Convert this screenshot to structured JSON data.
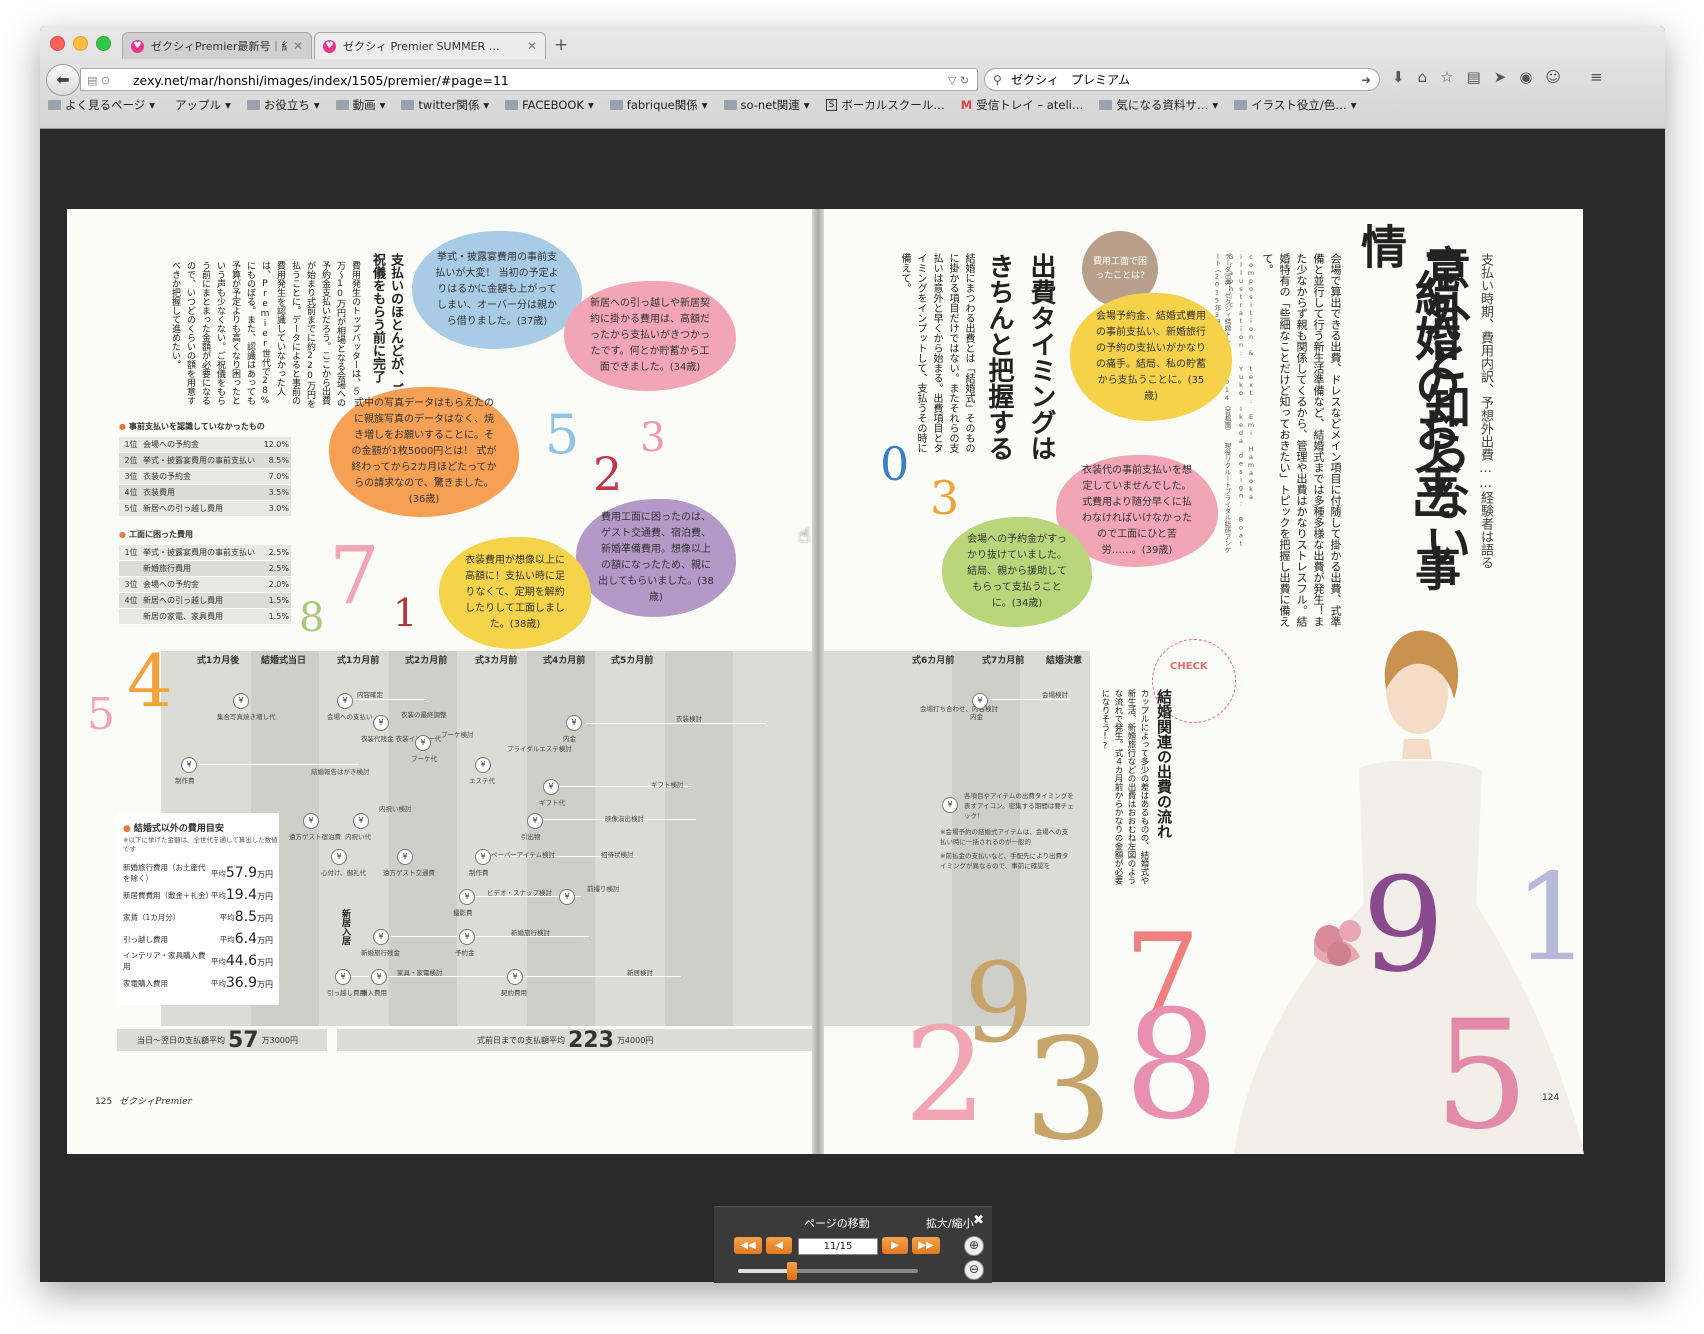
{
  "tabs": [
    {
      "title": "ゼクシィPremier最新号｜結…"
    },
    {
      "title": "ゼクシィ Premier SUMMER …"
    }
  ],
  "url": "zexy.net/mar/honshi/images/index/1505/premier/#page=11",
  "search_text": "ゼクシィ　プレミアム",
  "bookmarks": [
    "よく見るページ",
    "アップル",
    "お役立ち",
    "動画",
    "twitter関係",
    "FACEBOOK",
    "fabrique関係",
    "so-net関連",
    "ボーカルスクール…",
    "受信トレイ – ateli…",
    "気になる資料サ…",
    "イラスト役立/色…"
  ],
  "magazine": {
    "right": {
      "kicker": "支払い時期、費用内訳、予想外出費……経験者は語る",
      "title1": "意外と知らない",
      "title2": "「結婚のお金」事情",
      "lead": "会場で算出できる出費、ドレスなどメイン項目に付随して掛かる出費、式準備と並行して行う新生活準備など、結婚式までは多種多様な出費が発生！また少なからず親も関係してくるから、管理や出費はかなりストレスフル。結婚特有の「些細なことだけど知っておきたい」トピックを把握し出費に備えて。",
      "credit": "composition & text: Emi Hamaoka　illustration: Yuko Ikeda　design: Boat Graphic",
      "credit2": "データ出典：ゼクシィ結婚トレンド調査2014（首都圏）\n現役リクルートブライダル総研アンケート（2015年3月実施）",
      "sub1": "出費タイミングは",
      "sub2": "きちんと把握する",
      "sub_body": "結婚にまつわる出費とは「結婚式」そのものに掛かる項目だけではない。またそれらの支払いは意外と早くから始まる。出費項目とタイミングをインプットして、支払うその時に備えて。",
      "badge": "費用工面で困ったことは?",
      "check_label": "CHECK",
      "check_title": "結婚関連の出費の流れ",
      "check_body": "カップルによって多少の差はあるものの、結婚式や新生活、新婚旅行などの出費はおおむね左図のような流れで発生。式４カ月前からかなりの金額が必要になりそう!?",
      "page_no": "124"
    },
    "left": {
      "heading": "支払いのほとんどが、ご祝儀をもらう前に完了",
      "body": "費用発生のトップバッターは、５万〜10万円が相場となる会場への予約金支払いだろう。ここから出費が始まり式前までに約220万円を払うことに。データによると事前の費用発生を認識していなかった人は、Premier世代で28%にものぼる。また、認識はあっても予算が予定よりも高くなり困ったという声も少なくない。ご祝儀をもらう前にまとまった金額が必要になるので、いつどのくらいの額を用意すべきか把握して進めたい。",
      "page_no": "125",
      "logo": "ゼクシィPremier"
    },
    "quotes": [
      "挙式・披露宴費用の事前支払いが大変！ 当初の予定よりはるかに金額も上がってしまい、オーバー分は親から借りました。(37歳)",
      "新居への引っ越しや新居契約に掛かる費用は、高額だったから支払いがきつかったです。何とか貯蓄から工面できました。(34歳)",
      "式中の写真データはもらえたのに親族写真のデータはなく、焼き増しをお願いすることに。その金額が1枚5000円とは！ 式が終わってから2カ月ほどたってからの請求なので、驚きました。(36歳)",
      "費用工面に困ったのは、ゲスト交通費、宿泊費、新婚準備費用。想像以上の額になったため、親に出してもらいました。(38歳)",
      "衣装費用が想像以上に高額に！支払い時に足りなくて、定期を解約したりして工面しました。(38歳)",
      "会場予約金、結婚式費用の事前支払い、新婚旅行の予約の支払いがかなりの痛手。結局、私の貯蓄から支払うことに。(35歳)",
      "衣装代の事前支払いを想定していませんでした。式費用より随分早くに払わなければいけなかったので工面にひと苦労……。(39歳)",
      "会場への予約金がすっかり抜けていました。結局、親から援助してもらって支払うことに。(34歳)"
    ],
    "ranking1": {
      "title": "事前支払いを認識していなかったもの",
      "rows": [
        {
          "rank": "1位",
          "label": "会場への予約金",
          "pct": "12.0%"
        },
        {
          "rank": "2位",
          "label": "挙式・披露宴費用の事前支払い",
          "pct": "8.5%"
        },
        {
          "rank": "3位",
          "label": "衣装の予約金",
          "pct": "7.0%"
        },
        {
          "rank": "4位",
          "label": "衣装費用",
          "pct": "3.5%"
        },
        {
          "rank": "5位",
          "label": "新居への引っ越し費用",
          "pct": "3.0%"
        }
      ]
    },
    "ranking2": {
      "title": "工面に困った費用",
      "rows": [
        {
          "rank": "1位",
          "label": "挙式・披露宴費用の事前支払い",
          "pct": "2.5%"
        },
        {
          "rank": "",
          "label": "新婚旅行費用",
          "pct": "2.5%"
        },
        {
          "rank": "3位",
          "label": "会場への予約金",
          "pct": "2.0%"
        },
        {
          "rank": "4位",
          "label": "新居への引っ越し費用",
          "pct": "1.5%"
        },
        {
          "rank": "",
          "label": "新居の家電、家具費用",
          "pct": "1.5%"
        }
      ]
    },
    "timeline_headers": [
      "式1カ月後",
      "結婚式当日",
      "式1カ月前",
      "式2カ月前",
      "式3カ月前",
      "式4カ月前",
      "式5カ月前",
      "式6カ月前",
      "式7カ月前",
      "結婚決意"
    ],
    "timeline_items": [
      "集合写真焼き増し代",
      "会場への支払い",
      "内容確定",
      "衣装の最終調整",
      "衣装代残金 衣装インナー代",
      "ブーケ代",
      "ブーケ検討",
      "ブライダルエステ検討",
      "エステ代",
      "ギフト代",
      "ギフト検討",
      "内金",
      "衣装検討",
      "制作費",
      "結婚報告はがき検討",
      "遠方ゲスト宿泊費",
      "内祝い代",
      "内祝い検討",
      "引出物",
      "映像演出検討",
      "心付け、御礼代",
      "遠方ゲスト交通費",
      "ペーパーアイテム検討",
      "制作費",
      "招待状検討",
      "撮影費",
      "ビデオ・スナップ検討",
      "前撮り検討",
      "予約金",
      "新婚旅行検討",
      "新婚旅行残金",
      "新居入居",
      "家具・家電検討",
      "引っ越し費用",
      "購入費用",
      "新居検討",
      "契約費用",
      "会場打ち合わせ、内容検討",
      "会場検討",
      "各項目やアイテムの出費タイミングを表すアイコン。密集する期間は要チェック！",
      "※会場予約の結婚式アイテムは、会場への支払い時に一括されるのが一般的",
      "※前払金の支払いなど、手配先により出費タイミングが異なるので、事前に確認を"
    ],
    "costs": {
      "title": "結婚式以外の費用目安",
      "note": "※以下に挙げた金額は、全世代を通して算出した数値です",
      "rows": [
        {
          "label": "新婚旅行費用（お土産代を除く）",
          "avg": "平均",
          "value": "57.9",
          "unit": "万円"
        },
        {
          "label": "新居費費用（敷金＋礼金）",
          "avg": "平均",
          "value": "19.4",
          "unit": "万円"
        },
        {
          "label": "家賃（1カ月分）",
          "avg": "平均",
          "value": "8.5",
          "unit": "万円"
        },
        {
          "label": "引っ越し費用",
          "avg": "平均",
          "value": "6.4",
          "unit": "万円"
        },
        {
          "label": "インテリア・家具購入費用",
          "avg": "平均",
          "value": "44.6",
          "unit": "万円"
        },
        {
          "label": "家電購入費用",
          "avg": "平均",
          "value": "36.9",
          "unit": "万円"
        }
      ]
    },
    "totals": [
      {
        "label": "当日〜翌日の支払額平均",
        "big": "57",
        "small": "万3000円"
      },
      {
        "label": "式前日までの支払額平均",
        "big": "223",
        "small": "万4000円"
      }
    ],
    "deco_numbers": [
      "5",
      "2",
      "3",
      "7",
      "1",
      "8",
      "4",
      "5",
      "0",
      "3",
      "9",
      "7",
      "8",
      "5",
      "2",
      "3",
      "1",
      "9"
    ]
  },
  "viewer": {
    "nav_label": "ページの移動",
    "zoom_label": "拡大/縮小",
    "page_input": "11/15",
    "zoom_level": 0.3,
    "buttons": {
      "first": "◀◀",
      "prev": "◀",
      "next": "▶",
      "last": "▶▶",
      "zoom_in": "⊕",
      "zoom_out": "⊖",
      "close": "✖"
    }
  },
  "colors": {
    "accent": "#e67a3c",
    "pink": "#e8348f"
  }
}
